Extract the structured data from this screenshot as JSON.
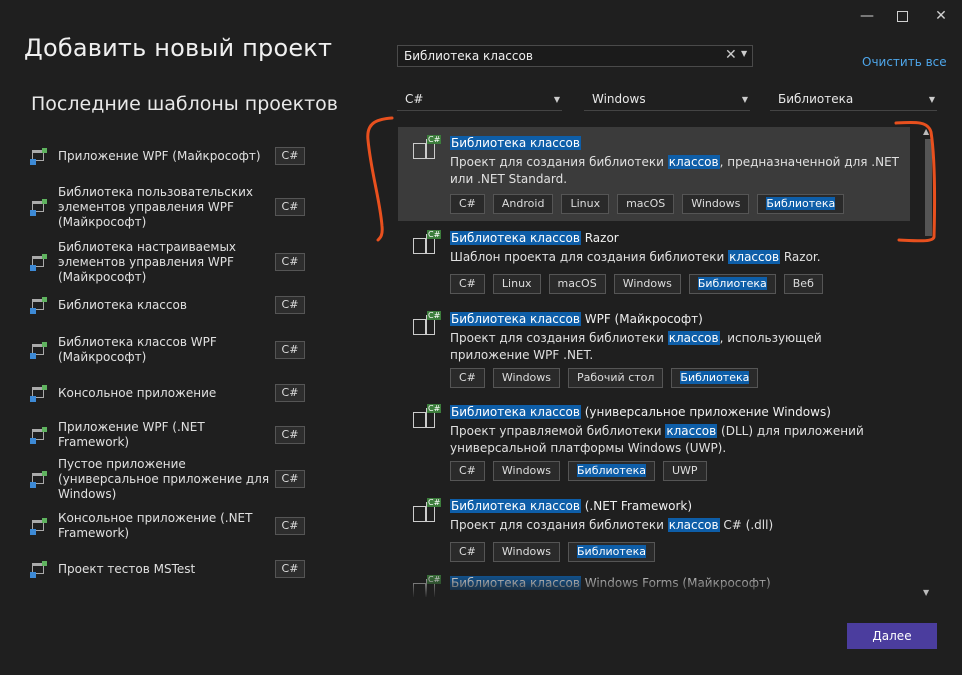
{
  "window": {
    "minimize_glyph": "—",
    "close_glyph": "✕"
  },
  "dialog": {
    "title": "Добавить новый проект"
  },
  "recent": {
    "title": "Последние шаблоны проектов",
    "items": [
      {
        "label": "Приложение WPF (Майкрософт)",
        "lang": "C#",
        "icon": "wpf-app-icon"
      },
      {
        "label": "Библиотека пользовательских элементов управления WPF (Майкрософт)",
        "lang": "C#",
        "icon": "wpf-control-library-icon"
      },
      {
        "label": "Библиотека настраиваемых элементов управления WPF (Майкрософт)",
        "lang": "C#",
        "icon": "wpf-custom-control-icon"
      },
      {
        "label": "Библиотека классов",
        "lang": "C#",
        "icon": "class-library-icon"
      },
      {
        "label": "Библиотека классов WPF (Майкрософт)",
        "lang": "C#",
        "icon": "wpf-class-library-icon"
      },
      {
        "label": "Консольное приложение",
        "lang": "C#",
        "icon": "console-app-icon"
      },
      {
        "label": "Приложение WPF (.NET Framework)",
        "lang": "C#",
        "icon": "wpf-framework-app-icon"
      },
      {
        "label": "Пустое приложение (универсальное приложение для Windows)",
        "lang": "C#",
        "icon": "uwp-app-icon"
      },
      {
        "label": "Консольное приложение (.NET Framework)",
        "lang": "C#",
        "icon": "console-framework-icon"
      },
      {
        "label": "Проект тестов MSTest",
        "lang": "C#",
        "icon": "mstest-icon"
      }
    ]
  },
  "search": {
    "value": "Библиотека классов",
    "clear_glyph": "✕",
    "dropdown_glyph": "▼"
  },
  "clear_all_label": "Очистить все",
  "filters": {
    "language": "C#",
    "platform": "Windows",
    "project_type": "Библиотека",
    "arrow_glyph": "▼"
  },
  "results": [
    {
      "title_hl": "Библиотека классов",
      "title_rest": "",
      "desc_a": "Проект для создания библиотеки ",
      "desc_hl": "классов",
      "desc_b": ", предназначенной для .NET или .NET Standard.",
      "tags": [
        {
          "t": "C#"
        },
        {
          "t": "Android"
        },
        {
          "t": "Linux"
        },
        {
          "t": "macOS"
        },
        {
          "t": "Windows"
        },
        {
          "t": "Библиотека",
          "hl": true
        }
      ]
    },
    {
      "title_hl": "Библиотека классов",
      "title_rest": " Razor",
      "desc_a": "Шаблон проекта для создания библиотеки ",
      "desc_hl": "классов",
      "desc_b": " Razor.",
      "tags": [
        {
          "t": "C#"
        },
        {
          "t": "Linux"
        },
        {
          "t": "macOS"
        },
        {
          "t": "Windows"
        },
        {
          "t": "Библиотека",
          "hl": true
        },
        {
          "t": "Веб"
        }
      ]
    },
    {
      "title_hl": "Библиотека классов",
      "title_rest": " WPF (Майкрософт)",
      "desc_a": "Проект для создания библиотеки ",
      "desc_hl": "классов",
      "desc_b": ", использующей приложение WPF .NET.",
      "tags": [
        {
          "t": "C#"
        },
        {
          "t": "Windows"
        },
        {
          "t": "Рабочий стол"
        },
        {
          "t": "Библиотека",
          "hl": true
        }
      ]
    },
    {
      "title_hl": "Библиотека классов",
      "title_rest": " (универсальное приложение Windows)",
      "desc_a": "Проект управляемой библиотеки ",
      "desc_hl": "классов",
      "desc_b": " (DLL) для приложений универсальной платформы Windows (UWP).",
      "tags": [
        {
          "t": "C#"
        },
        {
          "t": "Windows"
        },
        {
          "t": "Библиотека",
          "hl": true
        },
        {
          "t": "UWP"
        }
      ]
    },
    {
      "title_hl": "Библиотека классов",
      "title_rest": " (.NET Framework)",
      "desc_a": "Проект для создания библиотеки ",
      "desc_hl": "классов",
      "desc_b": " C# (.dll)",
      "tags": [
        {
          "t": "C#"
        },
        {
          "t": "Windows"
        },
        {
          "t": "Библиотека",
          "hl": true
        }
      ]
    },
    {
      "title_hl": "Библиотека классов",
      "title_rest": " Windows Forms (Майкрософт)",
      "desc_a": "",
      "desc_hl": "",
      "desc_b": "",
      "tags": []
    }
  ],
  "scroll": {
    "up_glyph": "▲",
    "down_glyph": "▼"
  },
  "next_button": "Далее",
  "colors": {
    "accent": "#4b3d9e",
    "highlight": "#0e5ea8",
    "annotation": "#e8501e",
    "link": "#4ea6ea"
  }
}
